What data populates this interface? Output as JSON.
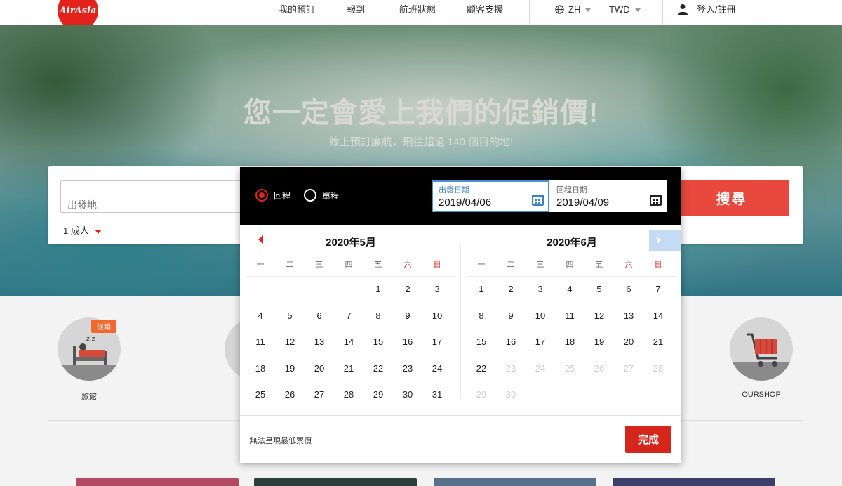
{
  "brand": {
    "logo_text": "AirAsia",
    "accent": "#e3221b"
  },
  "nav": {
    "items": [
      {
        "label": "我的預訂"
      },
      {
        "label": "報到"
      },
      {
        "label": "航班狀態"
      },
      {
        "label": "顧客支援"
      }
    ],
    "language": "ZH",
    "currency": "TWD",
    "login": "登入/註冊"
  },
  "hero": {
    "title": "您一定會愛上我們的促銷價!",
    "subtitle": "線上預訂廉航，飛往超過 140 個目的地!"
  },
  "booking": {
    "origin_placeholder": "出發地",
    "passengers": "1 成人",
    "search_label": "搜尋"
  },
  "calendar": {
    "trip_types": [
      {
        "label": "回程",
        "selected": true
      },
      {
        "label": "單程",
        "selected": false
      }
    ],
    "depart": {
      "label": "出發日期",
      "value": "2019/04/06"
    },
    "return": {
      "label": "回程日期",
      "value": "2019/04/09"
    },
    "weekdays": [
      "一",
      "二",
      "三",
      "四",
      "五",
      "六",
      "日"
    ],
    "months": [
      {
        "title": "2020年5月",
        "lead_blanks": 4,
        "days": 31,
        "disabled_from": null
      },
      {
        "title": "2020年6月",
        "lead_blanks": 0,
        "days": 30,
        "disabled_from": 23
      }
    ],
    "footer_note": "無法呈現最低票價",
    "done_label": "完成",
    "weekend_color": "#e3221b",
    "selected_field_color": "#4a8fd6"
  },
  "services": [
    {
      "label": "旅館",
      "badge": "促銷"
    },
    {
      "label": "OURSHOP",
      "badge": null
    }
  ]
}
